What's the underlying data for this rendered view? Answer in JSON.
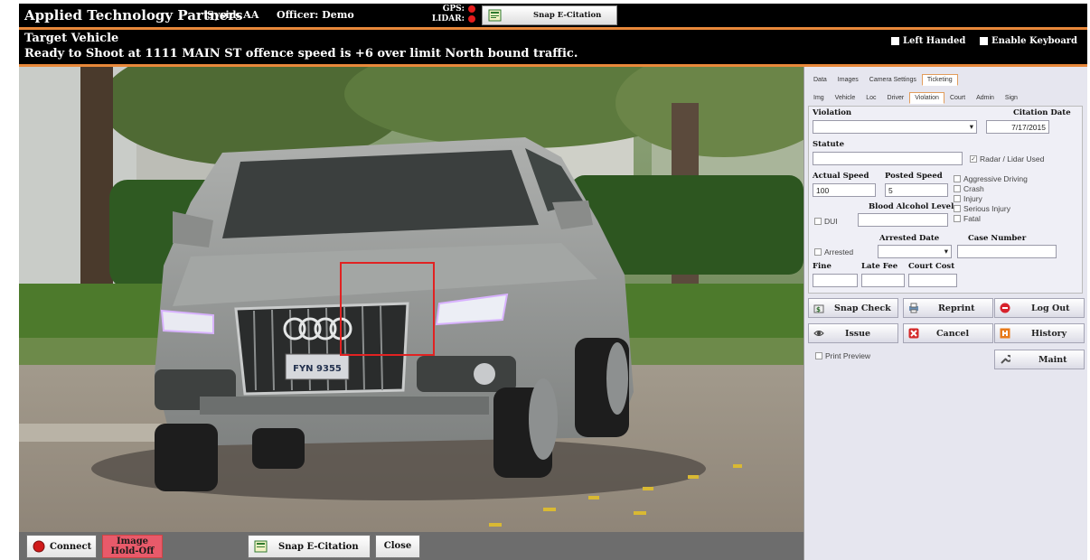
{
  "header": {
    "app_title": "Applied Technology Partners",
    "sysid": "Sysid: AA",
    "officer": "Officer: Demo",
    "gps_label": "GPS:",
    "lidar_label": "LIDAR:",
    "snap_button": "Snap E-Citation"
  },
  "status": {
    "line1": "Target Vehicle",
    "line2": "Ready to Shoot at 1111 MAIN ST offence speed is +6  over limit North bound traffic.",
    "left_handed": "Left Handed",
    "enable_keyboard": "Enable Keyboard"
  },
  "tabs_top": [
    "Data",
    "Images",
    "Camera Settings",
    "Ticketing"
  ],
  "tabs_sub": [
    "Img",
    "Vehicle",
    "Loc",
    "Driver",
    "Violation",
    "Court",
    "Admin",
    "Sign"
  ],
  "form": {
    "violation_label": "Violation",
    "violation_value": "",
    "citation_date_label": "Citation Date",
    "citation_date_value": "7/17/2015",
    "statute_label": "Statute",
    "statute_value": "",
    "radar_lidar": "Radar / Lidar Used",
    "actual_speed_label": "Actual Speed",
    "actual_speed_value": "100",
    "posted_speed_label": "Posted Speed",
    "posted_speed_value": "5",
    "aggressive_driving": "Aggressive Driving",
    "crash": "Crash",
    "injury": "Injury",
    "serious_injury": "Serious Injury",
    "fatal": "Fatal",
    "bac_label": "Blood Alcohol Level",
    "dui": "DUI",
    "arrested_date_label": "Arrested Date",
    "case_number_label": "Case Number",
    "arrested": "Arrested",
    "fine_label": "Fine",
    "late_fee_label": "Late Fee",
    "court_cost_label": "Court Cost"
  },
  "actions": {
    "snap_check": "Snap Check",
    "reprint": "Reprint",
    "log_out": "Log Out",
    "issue": "Issue",
    "cancel": "Cancel",
    "history": "History",
    "print_preview": "Print Preview",
    "maint": "Maint"
  },
  "bottom": {
    "connect": "Connect",
    "image_hold_1": "Image",
    "image_hold_2": "Hold-Off",
    "snap": "Snap E-Citation",
    "close": "Close"
  },
  "vehicle": {
    "plate": "FYN 9355"
  }
}
